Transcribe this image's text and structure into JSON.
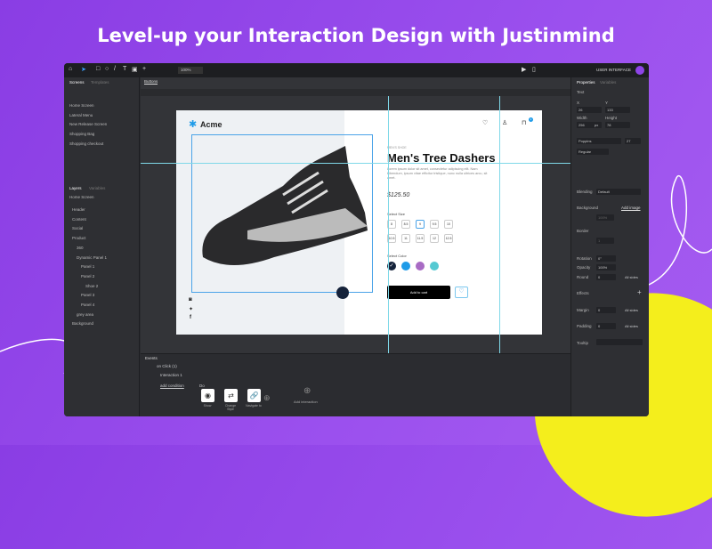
{
  "headline": "Level-up your Interaction Design with Justinmind",
  "toolbar": {
    "zoom": "100%",
    "user_interface": "USER INTERFACE"
  },
  "left": {
    "tabs": [
      "Screens",
      "Templates"
    ],
    "screens": [
      "Home Screen",
      "Lateral Menu",
      "New Release Screen",
      "Shopping Bag",
      "Shopping checkout"
    ],
    "layer_tabs": [
      "Layers",
      "Variables"
    ],
    "layer_root": "Home Screen",
    "layers": [
      "Header",
      "Content",
      "Social",
      "Product",
      "360",
      "Dynamic Panel 1",
      "Panel 1",
      "Panel 2",
      "Shoe 2",
      "Panel 3",
      "Panel 4",
      "grey area",
      "Background"
    ]
  },
  "canvas_tab": "Buttons",
  "product": {
    "brand": "Acme",
    "category": "MEN'S SHOE",
    "title": "Men's Tree Dashers",
    "description": "Lorem ipsum dolor sit amet, consectetur adipiscing elit. Nam bibendum, ipsum vitae efficitur tristique, nunc nulla ultrices arcu, sit amet.",
    "price": "$125.50",
    "select_size": "Select Size",
    "sizes": [
      "8",
      "8.5",
      "9",
      "9.5",
      "10",
      "10.5",
      "11",
      "11.5",
      "12",
      "12.5"
    ],
    "selected_size": "9",
    "select_color": "Select Color",
    "colors": [
      "#14223a",
      "#1e9be8",
      "#a86bc4",
      "#55c9d2"
    ],
    "add_to_cart": "Add to cart",
    "cart_count": "1"
  },
  "right": {
    "tabs": [
      "Properties",
      "Variables"
    ],
    "section": "Text",
    "x_label": "X",
    "x": "26",
    "y_label": "Y",
    "y": "133",
    "width_label": "Width",
    "width": "256",
    "height_label": "Height",
    "height": "78",
    "unit": "px",
    "font": "Poppins",
    "font_size": "27",
    "weight": "Regular",
    "blending_label": "Blending",
    "blending": "Default",
    "background_label": "Background",
    "add_image": "Add image",
    "bg_opacity": "100%",
    "border_label": "Border",
    "border_value": "1",
    "rotation_label": "Rotation",
    "rotation": "0°",
    "opacity_label": "Opacity",
    "opacity": "100%",
    "round_label": "Round",
    "round": "0",
    "all_sides": "All sides",
    "effects_label": "Effects",
    "margin_label": "Margin",
    "margin": "0",
    "padding_label": "Padding",
    "padding": "0",
    "tooltip_label": "Tooltip"
  },
  "events": {
    "tab": "Events",
    "event": "on Click (1)",
    "interaction": "Interaction 1",
    "add_condition": "add condition",
    "do": "Do",
    "actions": [
      "Show",
      "Change Style",
      "Navigate to"
    ],
    "add_interaction": "Add interaction"
  }
}
